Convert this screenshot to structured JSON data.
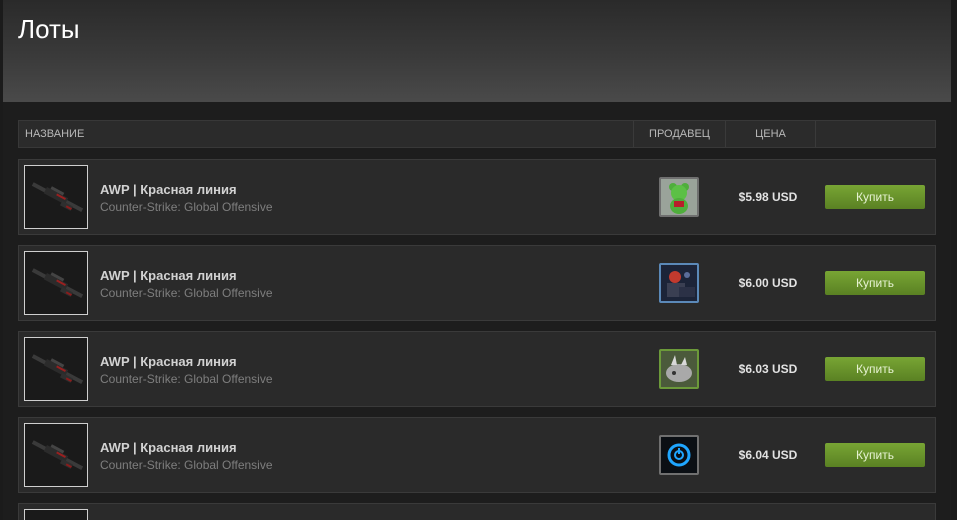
{
  "page": {
    "title": "Лоты"
  },
  "columns": {
    "name": "НАЗВАНИЕ",
    "seller": "ПРОДАВЕЦ",
    "price": "ЦЕНА"
  },
  "listings": [
    {
      "name": "AWP | Красная линия",
      "game": "Counter-Strike: Global Offensive",
      "price": "$5.98 USD",
      "buy_label": "Купить",
      "seller_avatar": "green-bear-avatar"
    },
    {
      "name": "AWP | Красная линия",
      "game": "Counter-Strike: Global Offensive",
      "price": "$6.00 USD",
      "buy_label": "Купить",
      "seller_avatar": "dark-character-avatar"
    },
    {
      "name": "AWP | Красная линия",
      "game": "Counter-Strike: Global Offensive",
      "price": "$6.03 USD",
      "buy_label": "Купить",
      "seller_avatar": "rhino-avatar"
    },
    {
      "name": "AWP | Красная линия",
      "game": "Counter-Strike: Global Offensive",
      "price": "$6.04 USD",
      "buy_label": "Купить",
      "seller_avatar": "power-button-avatar"
    }
  ],
  "colors": {
    "buy_button": "#6a9a2c",
    "background": "#1b1b1b",
    "row": "#2a2a2a"
  }
}
